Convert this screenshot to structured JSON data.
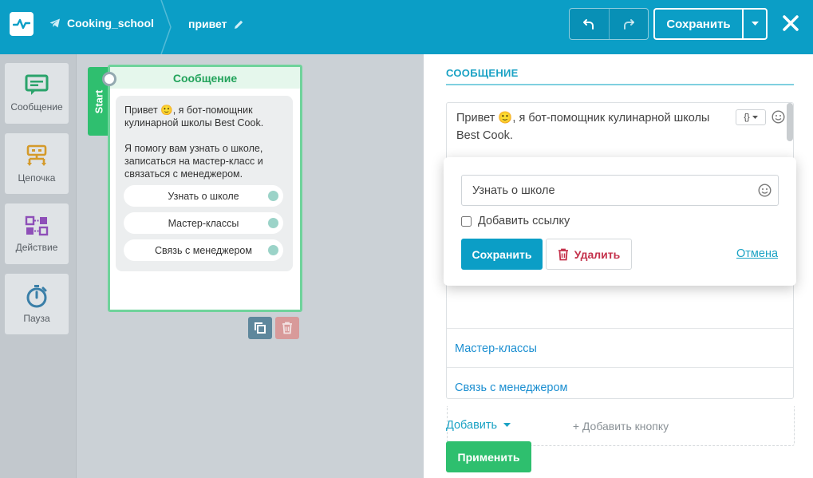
{
  "header": {
    "bot_name": "Cooking_school",
    "flow_name": "привет",
    "save_label": "Сохранить",
    "accent": "#0b9ec6"
  },
  "palette": {
    "items": [
      {
        "label": "Сообщение",
        "icon": "message-icon",
        "color": "#2aa36b"
      },
      {
        "label": "Цепочка",
        "icon": "chain-icon",
        "color": "#d49a2a"
      },
      {
        "label": "Действие",
        "icon": "action-icon",
        "color": "#8e4fb8"
      },
      {
        "label": "Пауза",
        "icon": "timer-icon",
        "color": "#3a7fa8"
      }
    ]
  },
  "node": {
    "start_label": "Start",
    "title": "Сообщение",
    "text": "Привет 🙂, я бот-помощник кулинарной школы Best Cook.\n\nЯ помогу вам узнать о школе, записаться на мастер-класс и связаться с менеджером.",
    "buttons": [
      "Узнать о школе",
      "Мастер-классы",
      "Связь с менеджером"
    ]
  },
  "panel": {
    "title": "СООБЩЕНИЕ",
    "message_text": "Привет 🙂, я бот-помощник кулинарной школы Best Cook.",
    "var_label": "{}",
    "buttons": [
      "Мастер-классы",
      "Связь с менеджером"
    ],
    "add_button_label": "+ Добавить кнопку",
    "add_menu_label": "Добавить",
    "apply_label": "Применить"
  },
  "popup": {
    "input_value": "Узнать о школе",
    "add_link_label": "Добавить ссылку",
    "save_label": "Сохранить",
    "delete_label": "Удалить",
    "cancel_label": "Отмена"
  }
}
